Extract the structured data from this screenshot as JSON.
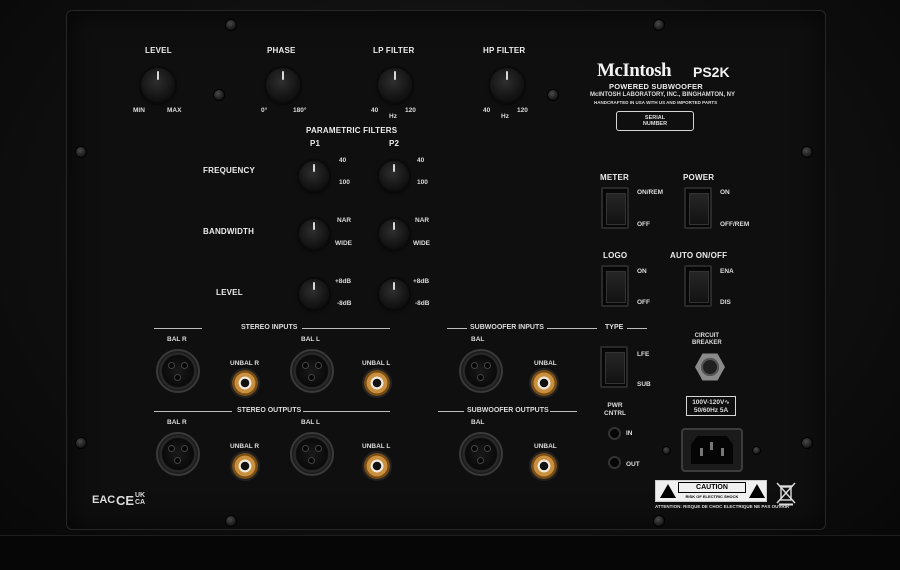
{
  "brand": {
    "logo": "McIntosh",
    "model": "PS2K",
    "subtitle": "POWERED SUBWOOFER",
    "company": "McINTOSH LABORATORY, INC., BINGHAMTON, NY",
    "origin": "HANDCRAFTED IN USA WITH US AND IMPORTED PARTS",
    "serial": "SERIAL\nNUMBER"
  },
  "top_controls": [
    {
      "label": "LEVEL",
      "left": "MIN",
      "right": "MAX"
    },
    {
      "label": "PHASE",
      "left": "0°",
      "right": "180°"
    },
    {
      "label": "LP FILTER",
      "left": "40",
      "mid": "Hz",
      "right": "120"
    },
    {
      "label": "HP FILTER",
      "left": "40",
      "mid": "Hz",
      "right": "120"
    }
  ],
  "parametric": {
    "title": "PARAMETRIC FILTERS",
    "p1": "P1",
    "p2": "P2",
    "rows": [
      {
        "label": "FREQUENCY",
        "hi": "40",
        "lo": "100"
      },
      {
        "label": "BANDWIDTH",
        "hi": "NAR",
        "lo": "WIDE"
      },
      {
        "label": "LEVEL",
        "hi": "+8dB",
        "lo": "-8dB"
      }
    ]
  },
  "switches": {
    "meter": {
      "label": "METER",
      "on": "ON/REM",
      "off": "OFF"
    },
    "power": {
      "label": "POWER",
      "on": "ON",
      "off": "OFF/REM"
    },
    "logo": {
      "label": "LOGO",
      "on": "ON",
      "off": "OFF"
    },
    "auto": {
      "label": "AUTO ON/OFF",
      "on": "ENA",
      "off": "DIS"
    },
    "type": {
      "label": "TYPE",
      "on": "LFE",
      "off": "SUB"
    }
  },
  "stereo_inputs": {
    "title": "STEREO INPUTS",
    "bal_r": "BAL R",
    "unbal_r": "UNBAL R",
    "bal_l": "BAL L",
    "unbal_l": "UNBAL L"
  },
  "stereo_outputs": {
    "title": "STEREO OUTPUTS",
    "bal_r": "BAL R",
    "unbal_r": "UNBAL R",
    "bal_l": "BAL L",
    "unbal_l": "UNBAL L"
  },
  "sub_inputs": {
    "title": "SUBWOOFER INPUTS",
    "bal": "BAL",
    "unbal": "UNBAL"
  },
  "sub_outputs": {
    "title": "SUBWOOFER OUTPUTS",
    "bal": "BAL",
    "unbal": "UNBAL"
  },
  "circuit_breaker": "CIRCUIT\nBREAKER",
  "pwr_cntrl": {
    "label": "PWR\nCNTRL",
    "in": "IN",
    "out": "OUT"
  },
  "voltage": {
    "line1": "100V-120V∿",
    "line2": "50/60Hz 5A"
  },
  "caution": {
    "title": "CAUTION",
    "sub": "RISK OF ELECTRIC SHOCK",
    "attention": "ATTENTION: RISQUE DE CHOC ELECTRIQUE NE PAS OUVRIR"
  },
  "certs": {
    "eac": "EAC",
    "ce": "CE",
    "ukca": "UK\nCA"
  }
}
